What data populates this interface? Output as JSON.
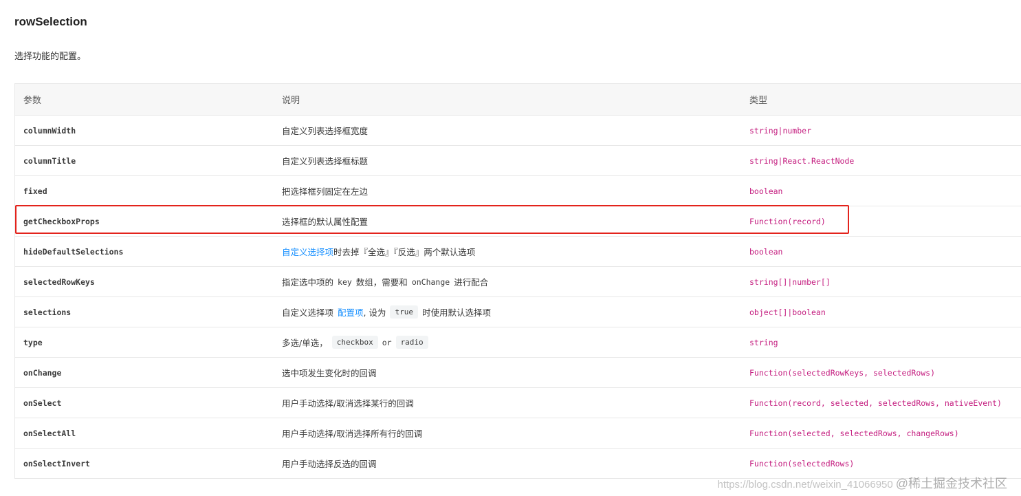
{
  "section": {
    "title": "rowSelection",
    "description": "选择功能的配置。"
  },
  "table": {
    "columns": [
      "参数",
      "说明",
      "类型"
    ],
    "rows": [
      {
        "name": "columnWidth",
        "desc": "自定义列表选择框宽度",
        "type": "string|number"
      },
      {
        "name": "columnTitle",
        "desc": "自定义列表选择框标题",
        "type": "string|React.ReactNode"
      },
      {
        "name": "fixed",
        "desc": "把选择框列固定在左边",
        "type": "boolean"
      },
      {
        "name": "getCheckboxProps",
        "desc": "选择框的默认属性配置",
        "type": "Function(record)"
      },
      {
        "name": "hideDefaultSelections",
        "desc_link": "自定义选择项",
        "desc_rest": "时去掉『全选』『反选』两个默认选项",
        "type": "boolean"
      },
      {
        "name": "selectedRowKeys",
        "desc_1": "指定选中项的",
        "desc_code1": "key",
        "desc_2": "数组，需要和",
        "desc_code2": "onChange",
        "desc_3": "进行配合",
        "type": "string[]|number[]"
      },
      {
        "name": "selections",
        "desc_1": "自定义选择项",
        "desc_link": "配置项",
        "desc_2": ", 设为",
        "desc_tag": "true",
        "desc_3": "时使用默认选择项",
        "type": "object[]|boolean"
      },
      {
        "name": "type",
        "desc_1": "多选/单选，",
        "desc_tag1": "checkbox",
        "desc_or": "or",
        "desc_tag2": "radio",
        "type": "string"
      },
      {
        "name": "onChange",
        "desc": "选中项发生变化时的回调",
        "type": "Function(selectedRowKeys, selectedRows)"
      },
      {
        "name": "onSelect",
        "desc": "用户手动选择/取消选择某行的回调",
        "type": "Function(record, selected, selectedRows, nativeEvent)"
      },
      {
        "name": "onSelectAll",
        "desc": "用户手动选择/取消选择所有行的回调",
        "type": "Function(selected, selectedRows, changeRows)"
      },
      {
        "name": "onSelectInvert",
        "desc": "用户手动选择反选的回调",
        "type": "Function(selectedRows)"
      }
    ]
  },
  "annotation": {
    "highlight_row": "getCheckboxProps",
    "color": "#e3231c"
  },
  "watermark": {
    "url": "https://blog.csdn.net/weixin_41066950",
    "brand": "@稀土掘金技术社区"
  },
  "colors": {
    "type_text": "#c41d7f",
    "link": "#1890ff",
    "header_bg": "#f7f7f7",
    "border": "#e8e8e8"
  }
}
